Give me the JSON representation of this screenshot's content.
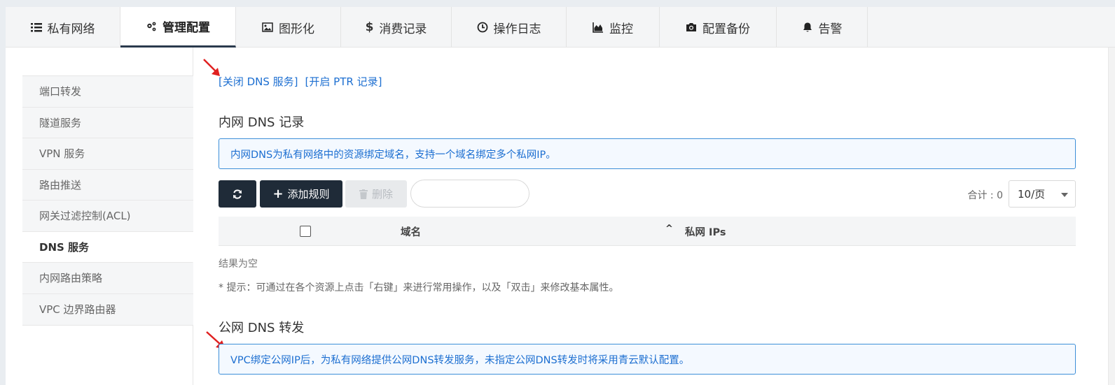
{
  "tabs": [
    {
      "label": "私有网络",
      "icon": "list-icon"
    },
    {
      "label": "管理配置",
      "icon": "gears-icon",
      "active": true
    },
    {
      "label": "图形化",
      "icon": "image-icon"
    },
    {
      "label": "消费记录",
      "icon": "dollar-icon"
    },
    {
      "label": "操作日志",
      "icon": "clock-icon"
    },
    {
      "label": "监控",
      "icon": "area-chart-icon"
    },
    {
      "label": "配置备份",
      "icon": "camera-icon"
    },
    {
      "label": "告警",
      "icon": "bell-icon"
    }
  ],
  "sidebar": {
    "items": [
      {
        "label": "端口转发"
      },
      {
        "label": "隧道服务"
      },
      {
        "label": "VPN 服务"
      },
      {
        "label": "路由推送"
      },
      {
        "label": "网关过滤控制(ACL)"
      },
      {
        "label": "DNS 服务",
        "active": true
      },
      {
        "label": "内网路由策略"
      },
      {
        "label": "VPC 边界路由器"
      }
    ]
  },
  "links": {
    "close_dns": "[关闭 DNS 服务]",
    "open_ptr": "[开启 PTR 记录]"
  },
  "dns_records": {
    "title": "内网 DNS 记录",
    "info": "内网DNS为私有网络中的资源绑定域名，支持一个域名绑定多个私网IP。",
    "toolbar": {
      "add_label": "添加规则",
      "delete_label": "删除",
      "search_placeholder": "",
      "total_label": "合计 : 0",
      "page_size": "10/页"
    },
    "table": {
      "col_domain": "域名",
      "col_ips": "私网 IPs",
      "sort_glyph": "^"
    },
    "empty_text": "结果为空",
    "tip": "* 提示：可通过在各个资源上点击「右键」来进行常用操作，以及「双击」来修改基本属性。"
  },
  "dns_forward": {
    "title": "公网 DNS 转发",
    "info": "VPC绑定公网IP后，为私有网络提供公网DNS转发服务，未指定公网DNS转发时将采用青云默认配置。"
  },
  "colors": {
    "accent": "#1d6fd1",
    "dark_button": "#1f2b38",
    "annotation_arrow": "#e02020"
  }
}
